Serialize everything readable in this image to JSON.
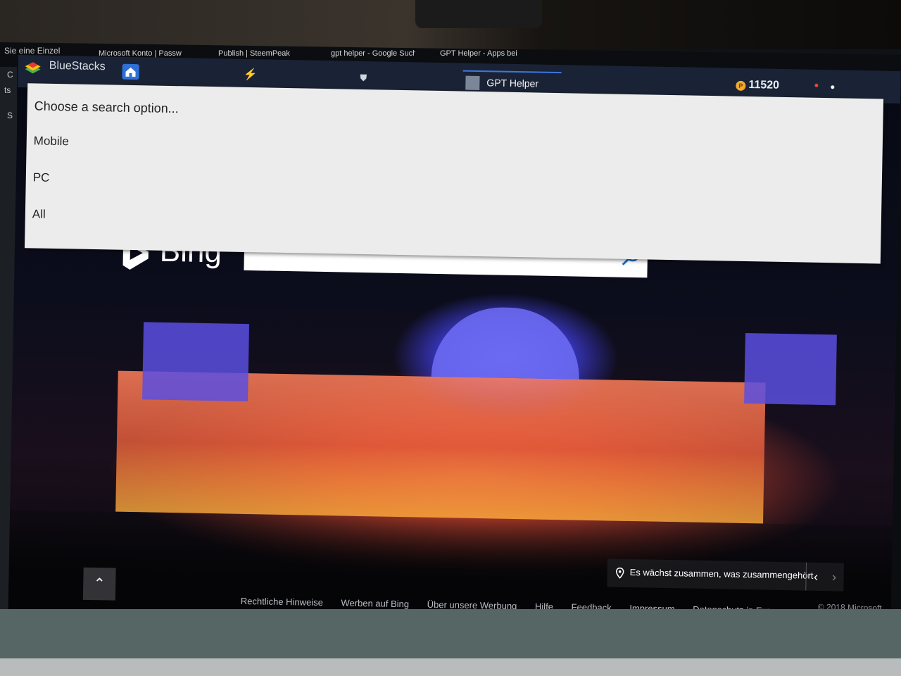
{
  "host_browser": {
    "tabs": [
      "Microsoft Konto | Passw",
      "Publish | SteemPeak",
      "gpt helper - Google Suche",
      "GPT Helper - Apps bei"
    ],
    "side_labels": [
      "Sie eine Einzel",
      "C",
      "ts",
      "S"
    ]
  },
  "bluestacks": {
    "title": "BlueStacks",
    "app_tab_label": "GPT Helper",
    "coins": "11520",
    "icons": {
      "logo": "bluestacks-logo",
      "home": "home-icon",
      "lightning": "lightning-icon",
      "shield": "shield-icon",
      "coin": "coin-icon"
    },
    "colors": {
      "titlebar": "#1a2335",
      "accent": "#3b77e0",
      "coin": "#f0a92e"
    }
  },
  "dropdown": {
    "header": "Choose a search option...",
    "options": [
      "Mobile",
      "PC",
      "All"
    ]
  },
  "bing": {
    "brand": "Bing",
    "search_value": "",
    "image_caption": "Es wächst zusammen, was zusammengehört",
    "footer_links": [
      "Rechtliche Hinweise",
      "Werben auf Bing",
      "Über unsere Werbung",
      "Hilfe",
      "Feedback",
      "Impressum",
      "Datenschutz in Europa"
    ],
    "copyright": "© 2018 Microsoft"
  }
}
